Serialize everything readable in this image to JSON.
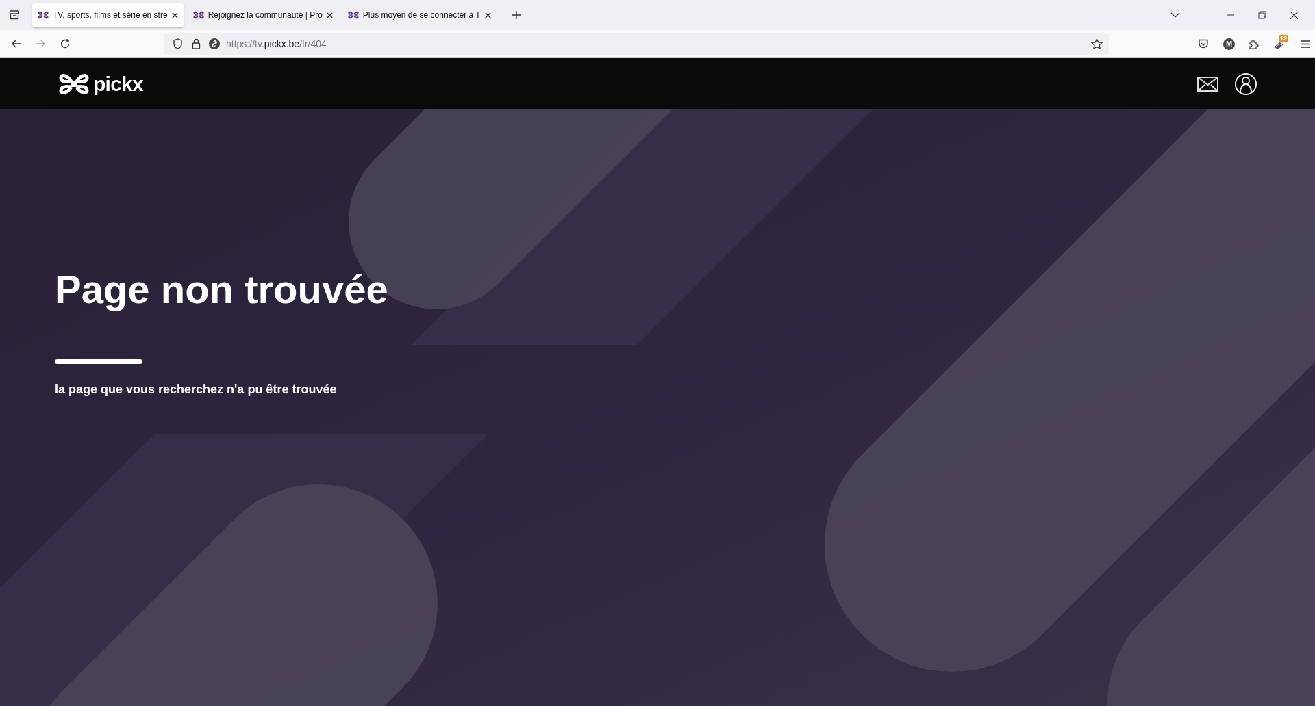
{
  "tabs": [
    {
      "title": "TV, sports, films et série en stre",
      "selected": true
    },
    {
      "title": "Rejoignez la communauté | Pro",
      "selected": false
    },
    {
      "title": "Plus moyen de se connecter à T",
      "selected": false
    }
  ],
  "address_bar": {
    "scheme_host": "https://tv.",
    "domain": "pickx.be",
    "path": "/fr/404"
  },
  "toolbar": {
    "account_initial": "M",
    "extension_badge": "12"
  },
  "site_header": {
    "logo_text": "pickx"
  },
  "error": {
    "title": "Page non trouvée",
    "message": "la page que vous recherchez n'a pu être trouvée"
  }
}
